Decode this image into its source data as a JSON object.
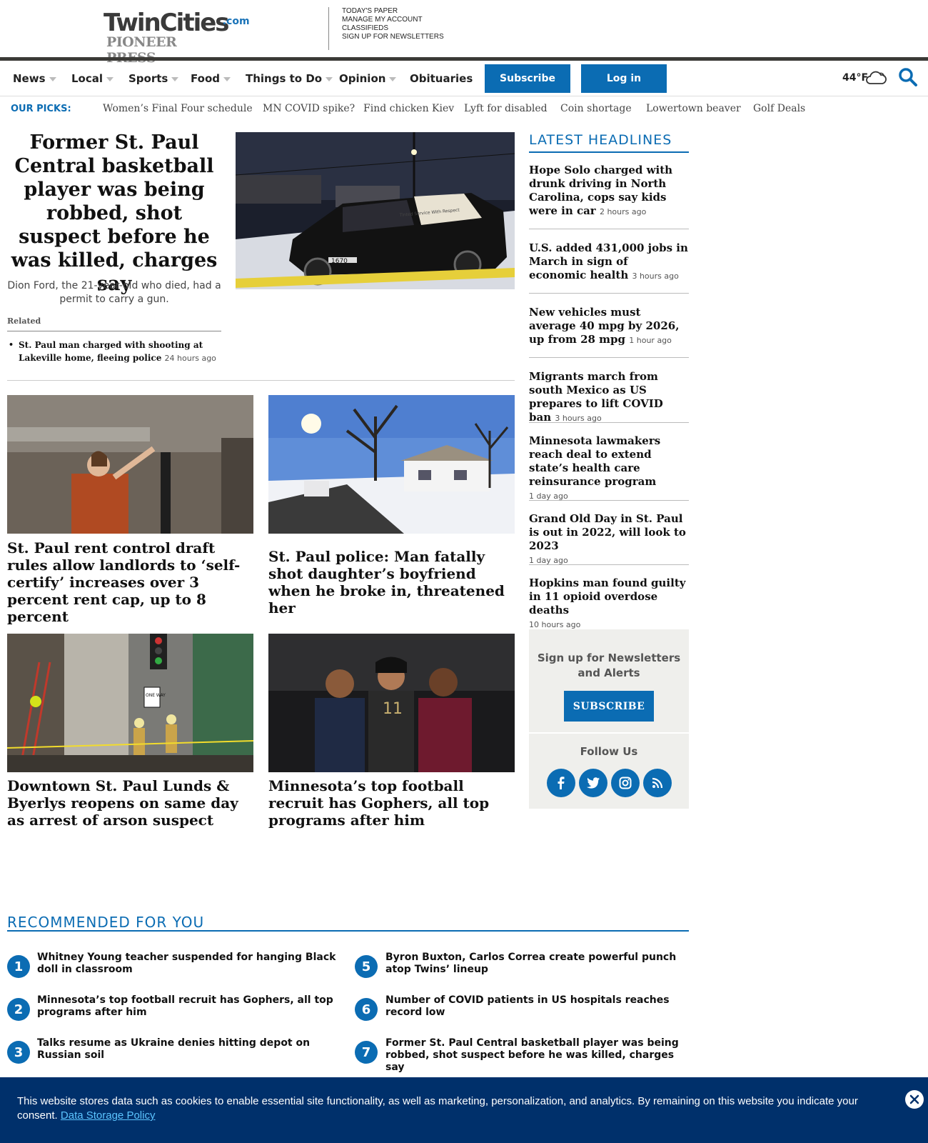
{
  "header": {
    "logo_line1": "TwinCities",
    "logo_com": ".com",
    "logo_line2": "PIONEER PRESS",
    "links": [
      "TODAY'S PAPER",
      "MANAGE MY ACCOUNT",
      "CLASSIFIEDS",
      "SIGN UP FOR NEWSLETTERS"
    ]
  },
  "nav": {
    "items": [
      "News",
      "Local",
      "Sports",
      "Food",
      "Things to Do",
      "Opinion",
      "Obituaries"
    ],
    "subscribe": "Subscribe",
    "login": "Log in",
    "weather": "44°F",
    "icons": [
      "cloud-icon",
      "search-icon"
    ]
  },
  "picks": {
    "label": "OUR PICKS:",
    "items": [
      "Women’s Final Four schedule",
      "MN COVID spike?",
      "Find chicken Kiev",
      "Lyft for disabled",
      "Coin shortage",
      "Lowertown beaver",
      "Golf Deals"
    ]
  },
  "lead": {
    "headline": "Former St. Paul Central basketball player was being robbed, shot suspect before he was killed, charges say",
    "dek": "Dion Ford, the 21-year-old who died, had a permit to carry a gun.",
    "related_label": "Related",
    "related_title": "St. Paul man charged with shooting at Lakeville home, fleeing police",
    "related_time": "24 hours ago",
    "image_text": "Tinted Service With Respect"
  },
  "cards": [
    {
      "title": "St. Paul rent control draft rules allow landlords to ‘self-certify’ increases over 3 percent rent cap, up to 8 percent"
    },
    {
      "title": "St. Paul police: Man fatally shot daughter’s boyfriend when he broke in, threatened her"
    },
    {
      "title": "Downtown St. Paul Lunds & Byerlys reopens on same day as arrest of arson suspect",
      "sign": "ONE WAY"
    },
    {
      "title": "Minnesota’s top football recruit has Gophers, all top programs after him"
    }
  ],
  "latest": {
    "title": "LATEST HEADLINES",
    "items": [
      {
        "title": "Hope Solo charged with drunk driving in North Carolina, cops say kids were in car",
        "time": "2 hours ago"
      },
      {
        "title": "U.S. added 431,000 jobs in March in sign of economic health",
        "time": "3 hours ago"
      },
      {
        "title": "New vehicles must average 40 mpg by 2026, up from 28 mpg",
        "time": "1 hour ago"
      },
      {
        "title": "Migrants march from south Mexico as US prepares to lift COVID ban",
        "time": "3 hours ago"
      },
      {
        "title": "Minnesota lawmakers reach deal to extend state’s health care reinsurance program",
        "time": "1 day ago"
      },
      {
        "title": "Grand Old Day in St. Paul is out in 2022, will look to 2023",
        "time": "1 day ago"
      },
      {
        "title": "Hopkins man found guilty in 11 opioid overdose deaths",
        "time": "10 hours ago"
      }
    ]
  },
  "newsletter": {
    "title": "Sign up for Newsletters and Alerts",
    "button": "SUBSCRIBE",
    "follow": "Follow Us",
    "social_icons": [
      "facebook-icon",
      "twitter-icon",
      "instagram-icon",
      "rss-icon"
    ]
  },
  "recommended": {
    "title": "RECOMMENDED FOR YOU",
    "items": [
      {
        "num": "1",
        "title": "Whitney Young teacher suspended for hanging Black doll in classroom"
      },
      {
        "num": "2",
        "title": "Minnesota’s top football recruit has Gophers, all top programs after him"
      },
      {
        "num": "3",
        "title": "Talks resume as Ukraine denies hitting depot on Russian soil"
      },
      {
        "num": "5",
        "title": "Byron Buxton, Carlos Correa create powerful punch atop Twins’ lineup"
      },
      {
        "num": "6",
        "title": "Number of COVID patients in US hospitals reaches record low"
      },
      {
        "num": "7",
        "title": "Former St. Paul Central basketball player was being robbed, shot suspect before he was killed, charges say"
      }
    ]
  },
  "cookie": {
    "text": "This website stores data such as cookies to enable essential site functionality, as well as marketing, personalization, and analytics. By remaining on this website you indicate your consent.",
    "link": "Data Storage Policy"
  },
  "colors": {
    "accent": "#0b6cb3",
    "banner": "#00306b",
    "header_rule": "#3b3a36"
  }
}
